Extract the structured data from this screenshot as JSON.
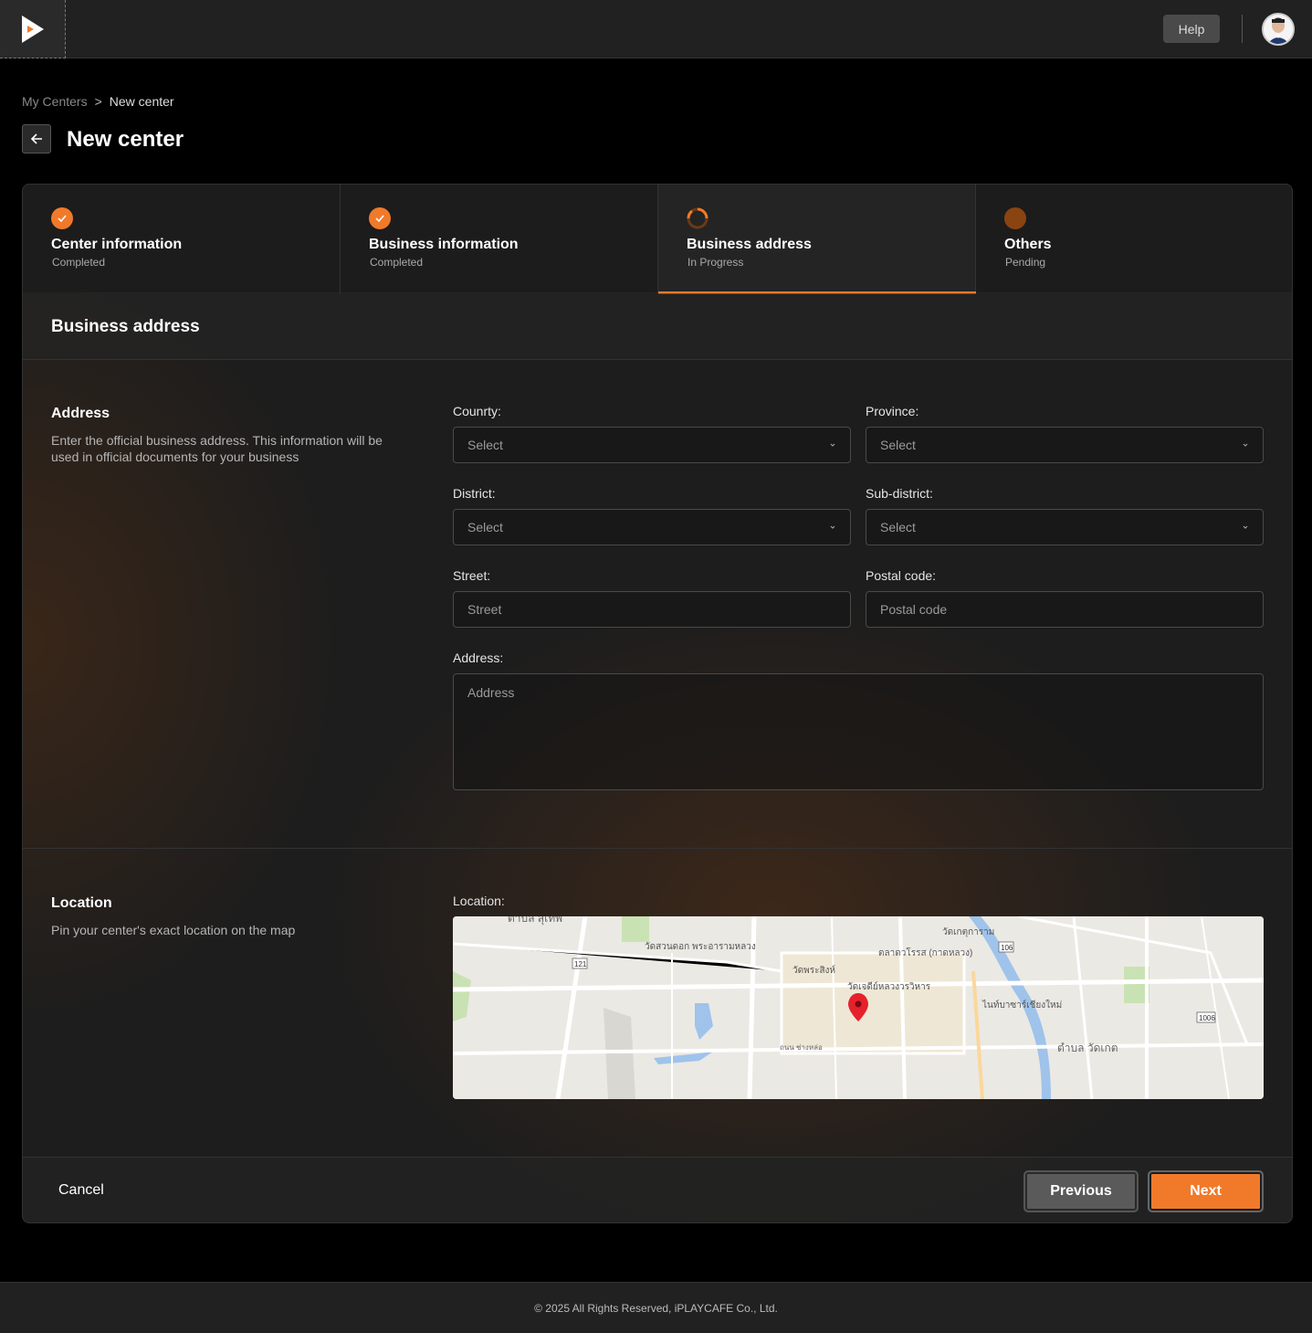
{
  "header": {
    "help_label": "Help"
  },
  "breadcrumb": {
    "parent": "My Centers",
    "separator": ">",
    "current": "New center"
  },
  "page": {
    "title": "New center"
  },
  "steps": [
    {
      "title": "Center information",
      "status": "Completed"
    },
    {
      "title": "Business information",
      "status": "Completed"
    },
    {
      "title": "Business address",
      "status": "In Progress"
    },
    {
      "title": "Others",
      "status": "Pending"
    }
  ],
  "section": {
    "title": "Business address"
  },
  "address_group": {
    "title": "Address",
    "description_line1": "Enter the official business address. This information will be",
    "description_line2": "used in official documents for your business"
  },
  "fields": {
    "country": {
      "label": "Counrty:",
      "placeholder": "Select"
    },
    "province": {
      "label": "Province:",
      "placeholder": "Select"
    },
    "district": {
      "label": "District:",
      "placeholder": "Select"
    },
    "subdistrict": {
      "label": "Sub-district:",
      "placeholder": "Select"
    },
    "street": {
      "label": "Street:",
      "placeholder": "Street"
    },
    "postal": {
      "label": "Postal code:",
      "placeholder": "Postal code"
    },
    "address": {
      "label": "Address:",
      "placeholder": "Address"
    }
  },
  "location_group": {
    "title": "Location",
    "description": "Pin your center's exact location on the map",
    "field_label": "Location:"
  },
  "map_labels": {
    "l1": "วัดสวนดอก พระอารามหลวง",
    "l2": "วัดพระสิงห์",
    "l3": "วัดเจดีย์หลวงวรวิหาร",
    "l4": "ตลาดวโรรส (กาดหลวง)",
    "l5": "วัดเกตุการาม",
    "l6": "ไนท์บาซาร์เชียงใหม่",
    "l7": "ตำบล วัดเกต",
    "l8": "ตำบล สุเทพ",
    "l9": "ถนน ช่างหล่อ",
    "r1": "121",
    "r2": "106",
    "r3": "1006"
  },
  "actions": {
    "cancel": "Cancel",
    "previous": "Previous",
    "next": "Next"
  },
  "footer": {
    "copyright": "© 2025 All Rights Reserved, iPLAYCAFE Co., Ltd."
  },
  "colors": {
    "accent": "#f07a2a",
    "pending": "#8a4412"
  }
}
